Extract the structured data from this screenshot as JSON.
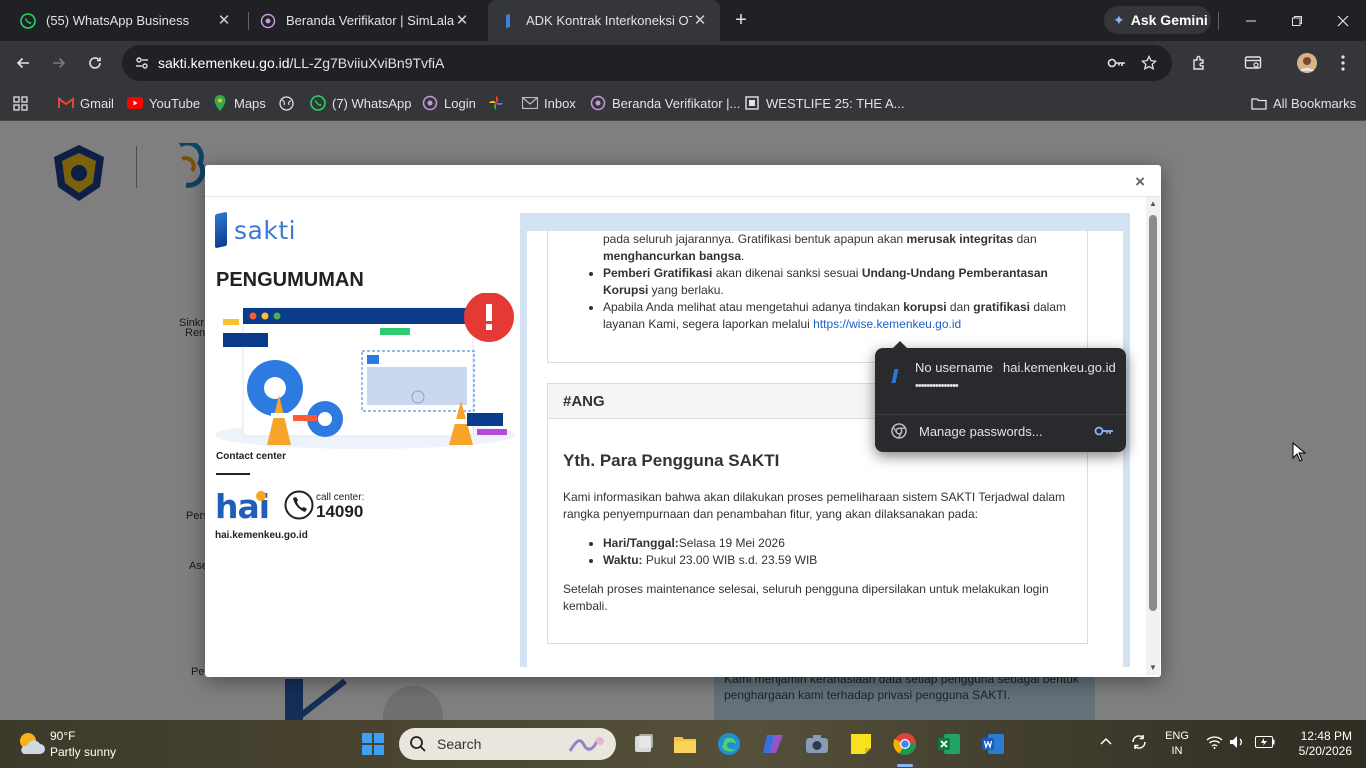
{
  "browser": {
    "tabs": [
      {
        "title": "(55) WhatsApp Business",
        "active": false
      },
      {
        "title": "Beranda Verifikator | SimLala",
        "active": false
      },
      {
        "title": "ADK Kontrak Interkoneksi OTP I",
        "active": true
      }
    ],
    "gemini_label": "Ask Gemini",
    "url_domain": "sakti.kemenkeu.go.id",
    "url_path": "/LL-Zg7BviiuXviBn9TvfiA",
    "bookmarks": [
      {
        "label": "Gmail",
        "icon": "gmail-icon"
      },
      {
        "label": "YouTube",
        "icon": "youtube-icon"
      },
      {
        "label": "Maps",
        "icon": "maps-icon"
      },
      {
        "label": "",
        "icon": "globe-icon"
      },
      {
        "label": "(7) WhatsApp",
        "icon": "whatsapp-icon"
      },
      {
        "label": "Login",
        "icon": "login-icon"
      },
      {
        "label": "",
        "icon": "photos-icon"
      },
      {
        "label": "Inbox",
        "icon": "inbox-icon"
      },
      {
        "label": "Beranda Verifikator |...",
        "icon": "simlala-icon"
      },
      {
        "label": "WESTLIFE 25: THE A...",
        "icon": "bookmark-page-icon"
      }
    ],
    "all_bookmarks": "All Bookmarks"
  },
  "page_bg": {
    "fragments": [
      "Sinkr",
      "Ren",
      "Pers",
      "Ase",
      "Pel"
    ],
    "info_box": "Kami menjamin kerahasiaan data setiap pengguna sebagai bentuk penghargaan kami terhadap privasi pengguna SAKTI."
  },
  "modal": {
    "close": "×",
    "logo_text": "sakti",
    "heading": "PENGUMUMAN",
    "contact_center": "Contact center",
    "hai": "hai",
    "call_center_label": "call center:",
    "call_center_number": "14090",
    "hai_domain": "hai.kemenkeu.go.id",
    "card1": {
      "pre_line_a": "pada seluruh jajarannya. Gratifikasi bentuk apapun akan ",
      "pre_bold_a": "merusak integritas",
      "pre_line_b": " dan ",
      "pre_bold_b": "menghancurkan bangsa",
      "pre_end": ".",
      "b2_bold1": "Pemberi Gratifikasi",
      "b2_text1": " akan dikenai sanksi sesuai ",
      "b2_bold2": "Undang-Undang Pemberantasan Korupsi",
      "b2_text2": " yang berlaku.",
      "b3_text1": "Apabila Anda melihat atau mengetahui adanya tindakan ",
      "b3_bold1": "korupsi",
      "b3_text2": " dan ",
      "b3_bold2": "gratifikasi",
      "b3_text3": " dalam layanan Kami, segera laporkan melalui ",
      "b3_link": "https://wise.kemenkeu.go.id"
    },
    "card2": {
      "tag": "#ANG",
      "title": "Yth. Para Pengguna SAKTI",
      "intro": "Kami informasikan bahwa akan dilakukan proses pemeliharaan sistem SAKTI Terjadwal dalam rangka penyempurnaan dan penambahan fitur, yang akan dilaksanakan pada:",
      "date_label": "Hari/Tanggal:",
      "date_value": "Selasa 19 Mei 2026",
      "time_label": "Waktu:",
      "time_value": " Pukul 23.00 WIB s.d. 23.59 WIB",
      "outro": "Setelah proses maintenance selesai, seluruh pengguna dipersilakan untuk melakukan login kembali."
    }
  },
  "password_popup": {
    "username": "No username",
    "site": "hai.kemenkeu.go.id",
    "password_mask": "•••••••••••••••",
    "manage": "Manage passwords..."
  },
  "taskbar": {
    "temperature": "90°F",
    "condition": "Partly sunny",
    "search_label": "Search",
    "lang_top": "ENG",
    "lang_bottom": "IN",
    "time": "12:48 PM",
    "date": "5/20/2026"
  },
  "colors": {
    "chrome_dark": "#202124",
    "chrome_toolbar": "#35363a",
    "modal_pane": "#d3e3f3",
    "link": "#1a62c4",
    "sakti_blue": "#3a7bd5"
  }
}
